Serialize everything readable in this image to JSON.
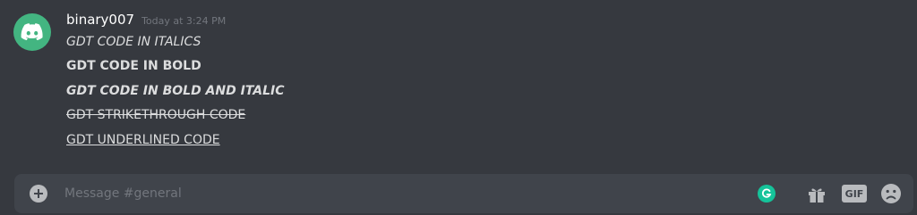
{
  "message": {
    "username": "binary007",
    "timestamp": "Today at 3:24 PM",
    "lines": [
      "GDT CODE IN ITALICS",
      "GDT CODE IN BOLD",
      "GDT CODE IN BOLD AND ITALIC",
      "GDT STRIKETHROUGH CODE",
      "GDT UNDERLINED CODE"
    ]
  },
  "composer": {
    "placeholder": "Message #general",
    "gif_label": "GIF"
  },
  "icons": {
    "avatar": "discord-logo-icon",
    "add": "plus-circle-icon",
    "grammarly": "grammarly-icon",
    "gift": "gift-icon",
    "emoji": "emoji-icon"
  },
  "colors": {
    "background": "#36393f",
    "composer": "#40444b",
    "avatar": "#43b581",
    "text": "#dcddde",
    "muted": "#72767d",
    "grammarly": "#15c39a"
  }
}
